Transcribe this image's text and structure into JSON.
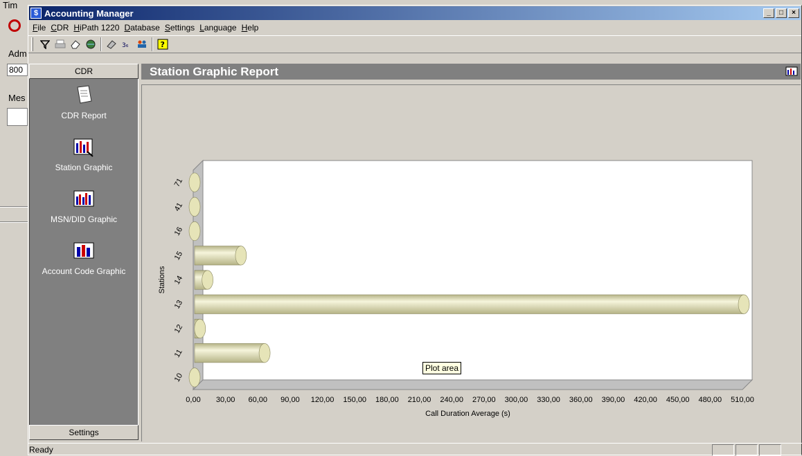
{
  "background_window": {
    "label_time": "Tim",
    "label_admin": "Adm",
    "field_value": "800",
    "label_message": "Mes"
  },
  "window": {
    "title": "Accounting Manager",
    "controls": {
      "minimize": "_",
      "maximize": "□",
      "close": "×"
    }
  },
  "menu": [
    "File",
    "CDR",
    "HiPath 1220",
    "Database",
    "Settings",
    "Language",
    "Help"
  ],
  "toolbar": {
    "icons": [
      "filter-icon",
      "print-icon",
      "eraser-icon",
      "globe-icon",
      "tape-icon",
      "number-icon",
      "people-icon",
      "help-icon"
    ]
  },
  "sidebar": {
    "header": "CDR",
    "footer": "Settings",
    "items": [
      {
        "label": "CDR Report",
        "icon": "report-icon"
      },
      {
        "label": "Station Graphic",
        "icon": "station-chart-icon"
      },
      {
        "label": "MSN/DID Graphic",
        "icon": "msn-chart-icon"
      },
      {
        "label": "Account Code Graphic",
        "icon": "account-chart-icon"
      }
    ]
  },
  "report": {
    "title": "Station Graphic Report"
  },
  "tooltip": "Plot area",
  "status": {
    "text": "Ready"
  },
  "chart_data": {
    "type": "bar",
    "orientation": "horizontal",
    "categories": [
      "10",
      "11",
      "12",
      "13",
      "14",
      "15",
      "16",
      "41",
      "71"
    ],
    "values": [
      0,
      65,
      5,
      510,
      12,
      43,
      0,
      0,
      0
    ],
    "xlabel": "Call Duration Average (s)",
    "ylabel": "Stations",
    "xlim": [
      0,
      510
    ],
    "xticks": [
      "0,00",
      "30,00",
      "60,00",
      "90,00",
      "120,00",
      "150,00",
      "180,00",
      "210,00",
      "240,00",
      "270,00",
      "300,00",
      "330,00",
      "360,00",
      "390,00",
      "420,00",
      "450,00",
      "480,00",
      "510,00"
    ],
    "grid": false,
    "colors": {
      "bar": "#e6e4b8",
      "bar_dark": "#b5b386",
      "wall": "#c0c0c0"
    }
  }
}
